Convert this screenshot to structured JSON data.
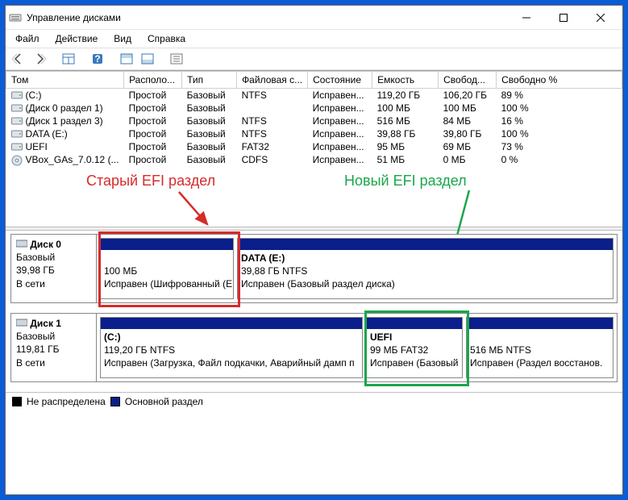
{
  "window": {
    "title": "Управление дисками"
  },
  "menu": {
    "file": "Файл",
    "action": "Действие",
    "view": "Вид",
    "help": "Справка"
  },
  "columns": {
    "volume": "Том",
    "layout": "Располо...",
    "type": "Тип",
    "fs": "Файловая с...",
    "status": "Состояние",
    "capacity": "Емкость",
    "free": "Свобод...",
    "freepct": "Свободно %"
  },
  "volumes": [
    {
      "name": "(C:)",
      "layout": "Простой",
      "type": "Базовый",
      "fs": "NTFS",
      "status": "Исправен...",
      "cap": "119,20 ГБ",
      "free": "106,20 ГБ",
      "pct": "89 %",
      "icon": "drive"
    },
    {
      "name": "(Диск 0 раздел 1)",
      "layout": "Простой",
      "type": "Базовый",
      "fs": "",
      "status": "Исправен...",
      "cap": "100 МБ",
      "free": "100 МБ",
      "pct": "100 %",
      "icon": "drive"
    },
    {
      "name": "(Диск 1 раздел 3)",
      "layout": "Простой",
      "type": "Базовый",
      "fs": "NTFS",
      "status": "Исправен...",
      "cap": "516 МБ",
      "free": "84 МБ",
      "pct": "16 %",
      "icon": "drive"
    },
    {
      "name": "DATA (E:)",
      "layout": "Простой",
      "type": "Базовый",
      "fs": "NTFS",
      "status": "Исправен...",
      "cap": "39,88 ГБ",
      "free": "39,80 ГБ",
      "pct": "100 %",
      "icon": "drive"
    },
    {
      "name": "UEFI",
      "layout": "Простой",
      "type": "Базовый",
      "fs": "FAT32",
      "status": "Исправен...",
      "cap": "95 МБ",
      "free": "69 МБ",
      "pct": "73 %",
      "icon": "drive"
    },
    {
      "name": "VBox_GAs_7.0.12 (...",
      "layout": "Простой",
      "type": "Базовый",
      "fs": "CDFS",
      "status": "Исправен...",
      "cap": "51 МБ",
      "free": "0 МБ",
      "pct": "0 %",
      "icon": "cd"
    }
  ],
  "annotations": {
    "old": "Старый EFI раздел",
    "new": "Новый EFI раздел"
  },
  "disks": [
    {
      "label": "Диск 0",
      "type": "Базовый",
      "size": "39,98 ГБ",
      "state": "В сети",
      "parts": [
        {
          "name": "",
          "line2": "100 МБ",
          "line3": "Исправен (Шифрованный (E",
          "flex": "0 0 166px"
        },
        {
          "name": "DATA  (E:)",
          "line2": "39,88 ГБ NTFS",
          "line3": "Исправен (Базовый раздел диска)",
          "flex": "1"
        }
      ]
    },
    {
      "label": "Диск 1",
      "type": "Базовый",
      "size": "119,81 ГБ",
      "state": "В сети",
      "parts": [
        {
          "name": "(C:)",
          "line2": "119,20 ГБ NTFS",
          "line3": "Исправен (Загрузка, Файл подкачки, Аварийный дамп п",
          "flex": "0 0 326px"
        },
        {
          "name": "UEFI",
          "line2": "99 МБ FAT32",
          "line3": "Исправен (Базовый",
          "flex": "0 0 120px"
        },
        {
          "name": "",
          "line2": "516 МБ NTFS",
          "line3": "Исправен (Раздел восстанов.",
          "flex": "1"
        }
      ]
    }
  ],
  "legend": {
    "unalloc": "Не распределена",
    "primary": "Основной раздел"
  }
}
